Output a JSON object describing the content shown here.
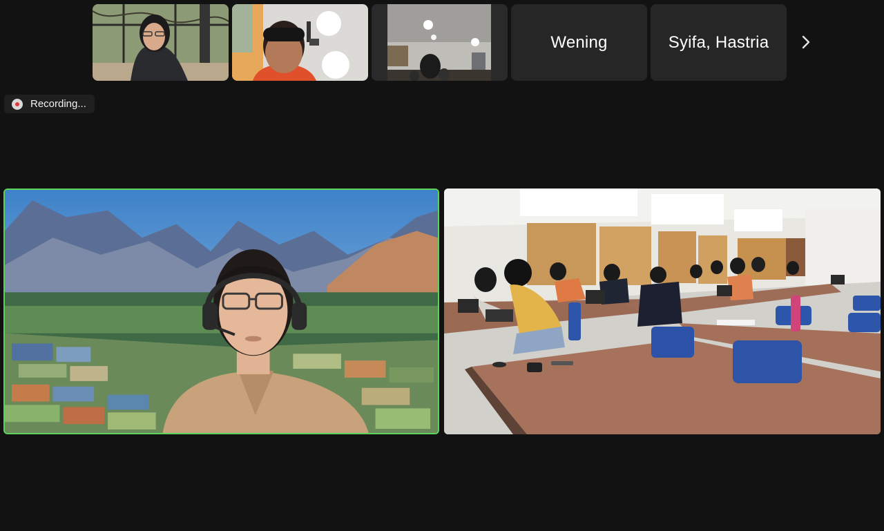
{
  "participants_strip": {
    "tiles": [
      {
        "type": "video",
        "subject": "woman-with-glasses-room"
      },
      {
        "type": "video",
        "subject": "man-white-wall"
      },
      {
        "type": "video",
        "subject": "classroom-ceiling-lights"
      },
      {
        "type": "name",
        "label": "Wening"
      },
      {
        "type": "name",
        "label": "Syifa, Hastria"
      }
    ],
    "next_icon": "chevron-right-icon"
  },
  "recording": {
    "label": "Recording...",
    "icon": "recording-dot-icon",
    "dot_color": "#e0383b"
  },
  "main_videos": [
    {
      "subject": "speaker-with-headset-mountain-background",
      "active_speaker": true,
      "highlight_color": "#5ad45a"
    },
    {
      "subject": "classroom-students-at-tables",
      "active_speaker": false
    }
  ]
}
